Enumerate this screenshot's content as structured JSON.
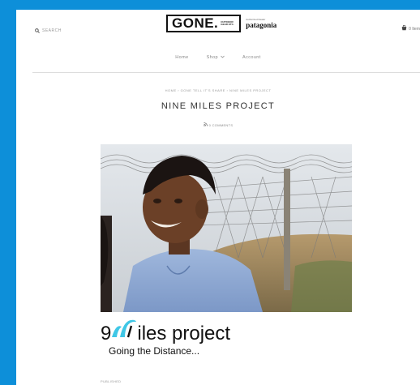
{
  "header": {
    "search_label": "Search",
    "logo_main": "GONE.",
    "logo_tagline": "Outdoor Gear Etc.",
    "logo_partner_small": "Authorized Dealer",
    "logo_partner_name": "patagonia",
    "cart_label": "0 Item"
  },
  "nav": {
    "items": [
      {
        "label": "Home"
      },
      {
        "label": "Shop"
      },
      {
        "label": "Account"
      }
    ]
  },
  "breadcrumb": "Home › Gone Tell It's Share › Nine Miles Project",
  "post": {
    "title": "Nine Miles Project",
    "subline": "0 Comments",
    "brand_number": "9",
    "brand_rest": "iles project",
    "brand_tagline": "Going the Distance...",
    "published": "Published"
  },
  "colors": {
    "frame": "#0d8fd9",
    "brand_accent": "#3fc7e6"
  }
}
